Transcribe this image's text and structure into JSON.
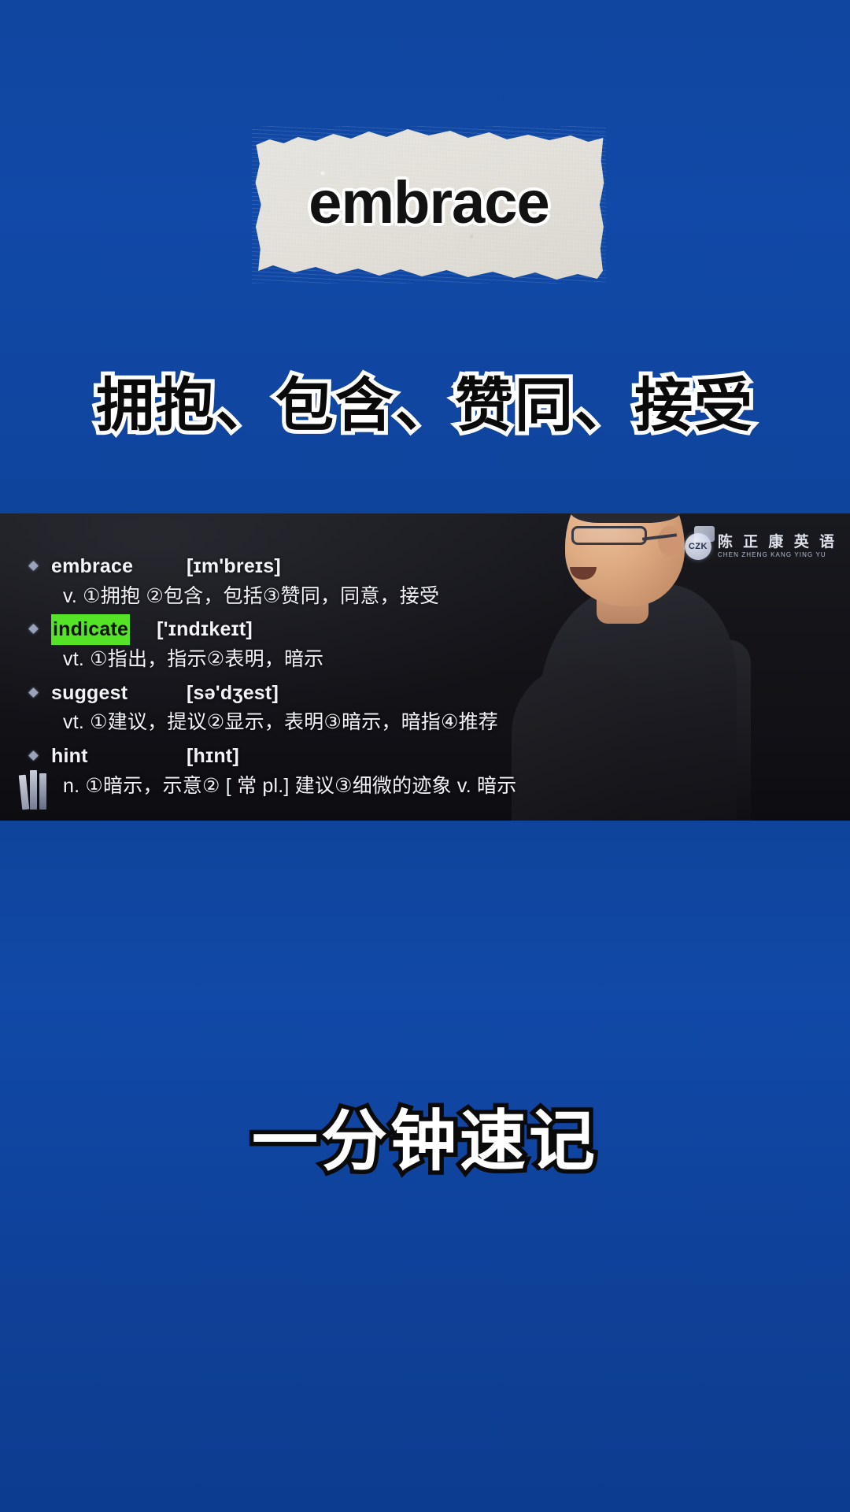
{
  "theme": {
    "background_blue": "#1149a8",
    "paper_color": "#e3e1da",
    "highlight_green": "#55e327",
    "video_background": "#141419"
  },
  "top": {
    "headword": "embrace",
    "chinese_meaning": "拥抱、包含、赞同、接受"
  },
  "video": {
    "watermark": {
      "badge": "CZK",
      "brand_cn": "陈 正 康 英 语",
      "brand_en": "CHEN ZHENG KANG YING YU"
    },
    "vocabulary": [
      {
        "term": "embrace",
        "ipa": "[ɪm'breɪs]",
        "highlighted": false,
        "pos": "v.",
        "definition": "①拥抱 ②包含，包括③赞同，同意，接受"
      },
      {
        "term": "indicate",
        "ipa": "['ɪndɪkeɪt]",
        "highlighted": true,
        "pos": "vt.",
        "definition": "①指出，指示②表明，暗示"
      },
      {
        "term": "suggest",
        "ipa": "[sə'dʒest]",
        "highlighted": false,
        "pos": "vt.",
        "definition": "①建议，提议②显示，表明③暗示，暗指④推荐"
      },
      {
        "term": "hint",
        "ipa": "[hɪnt]",
        "highlighted": false,
        "pos": "n.",
        "definition": "①暗示，示意② [ 常 pl.] 建议③细微的迹象 v. 暗示"
      }
    ]
  },
  "bottom": {
    "tagline": "一分钟速记"
  }
}
